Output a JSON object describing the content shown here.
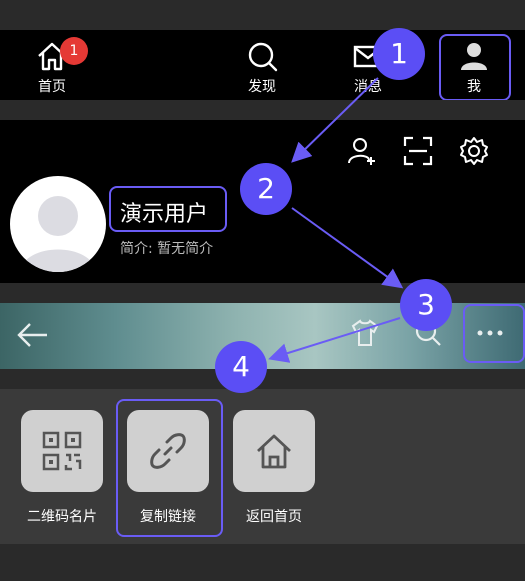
{
  "tabbar": {
    "home": {
      "label": "首页",
      "badge": "1",
      "icon": "home-icon"
    },
    "discover": {
      "label": "发现",
      "icon": "search-icon"
    },
    "messages": {
      "label": "消息",
      "icon": "mail-icon"
    },
    "me": {
      "label": "我",
      "icon": "user-icon"
    }
  },
  "profile": {
    "username": "演示用户",
    "bio": "简介: 暂无简介",
    "actions": [
      "add-friend-icon",
      "scan-icon",
      "settings-icon"
    ]
  },
  "banner": {
    "icons": [
      "back-arrow-icon",
      "tshirt-icon",
      "search-icon",
      "more-icon"
    ]
  },
  "share": {
    "items": [
      {
        "label": "二维码名片",
        "icon": "qrcode-icon"
      },
      {
        "label": "复制链接",
        "icon": "link-icon"
      },
      {
        "label": "返回首页",
        "icon": "home-icon"
      }
    ]
  },
  "steps": [
    "1",
    "2",
    "3",
    "4"
  ],
  "colors": {
    "accent": "#5b4ef5",
    "badge": "#e53935"
  }
}
